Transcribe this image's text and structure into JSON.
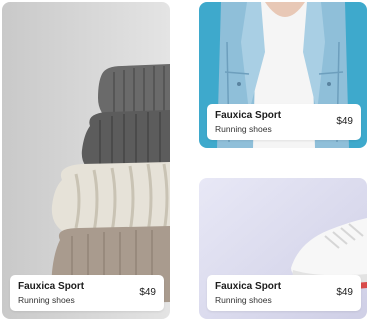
{
  "products": [
    {
      "image": "stacked-knit-sweaters",
      "title": "Fauxica Sport",
      "subtitle": "Running shoes",
      "price": "$49"
    },
    {
      "image": "denim-jacket-person",
      "title": "Fauxica Sport",
      "subtitle": "Running shoes",
      "price": "$49"
    },
    {
      "image": "white-sneaker",
      "title": "Fauxica Sport",
      "subtitle": "Running shoes",
      "price": "$49"
    }
  ],
  "colors": {
    "card_background": "#ffffff",
    "text_primary": "#1c1c1c",
    "jacket_bg": "#3ea9cc",
    "sneaker_bg": "#dcdcef"
  }
}
